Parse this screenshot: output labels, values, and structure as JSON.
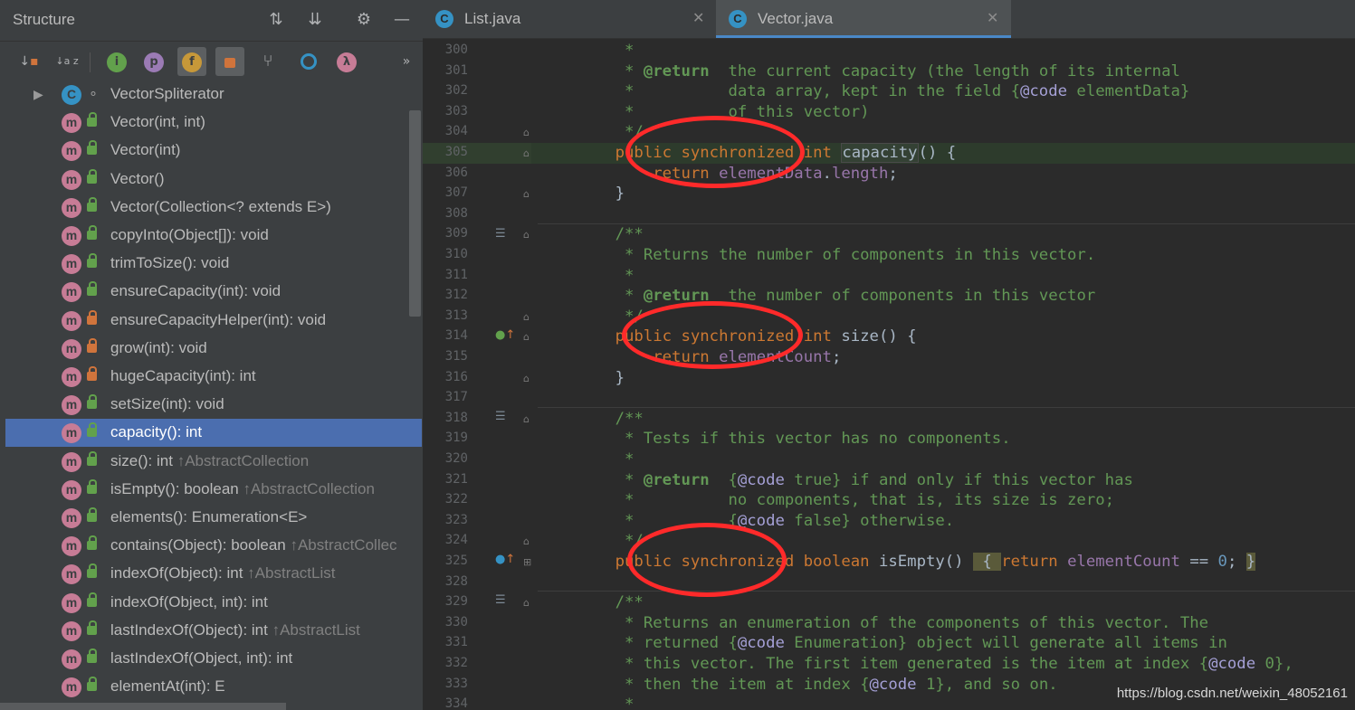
{
  "structure": {
    "title": "Structure",
    "items": [
      {
        "label": "VectorSpliterator",
        "sub": "",
        "kind": "class",
        "access": "package"
      },
      {
        "label": "Vector(int, int)",
        "sub": "",
        "kind": "method",
        "access": "public"
      },
      {
        "label": "Vector(int)",
        "sub": "",
        "kind": "method",
        "access": "public"
      },
      {
        "label": "Vector()",
        "sub": "",
        "kind": "method",
        "access": "public"
      },
      {
        "label": "Vector(Collection<? extends E>)",
        "sub": "",
        "kind": "method",
        "access": "public"
      },
      {
        "label": "copyInto(Object[]): void",
        "sub": "",
        "kind": "method",
        "access": "public"
      },
      {
        "label": "trimToSize(): void",
        "sub": "",
        "kind": "method",
        "access": "public"
      },
      {
        "label": "ensureCapacity(int): void",
        "sub": "",
        "kind": "method",
        "access": "public"
      },
      {
        "label": "ensureCapacityHelper(int): void",
        "sub": "",
        "kind": "method",
        "access": "private"
      },
      {
        "label": "grow(int): void",
        "sub": "",
        "kind": "method",
        "access": "private"
      },
      {
        "label": "hugeCapacity(int): int",
        "sub": "",
        "kind": "method",
        "access": "private"
      },
      {
        "label": "setSize(int): void",
        "sub": "",
        "kind": "method",
        "access": "public"
      },
      {
        "label": "capacity(): int",
        "sub": "",
        "kind": "method",
        "access": "public",
        "selected": true
      },
      {
        "label": "size(): int ",
        "sub": "↑AbstractCollection",
        "kind": "method",
        "access": "public"
      },
      {
        "label": "isEmpty(): boolean ",
        "sub": "↑AbstractCollection",
        "kind": "method",
        "access": "public"
      },
      {
        "label": "elements(): Enumeration<E>",
        "sub": "",
        "kind": "method",
        "access": "public"
      },
      {
        "label": "contains(Object): boolean ",
        "sub": "↑AbstractCollec",
        "kind": "method",
        "access": "public"
      },
      {
        "label": "indexOf(Object): int ",
        "sub": "↑AbstractList",
        "kind": "method",
        "access": "public"
      },
      {
        "label": "indexOf(Object, int): int",
        "sub": "",
        "kind": "method",
        "access": "public"
      },
      {
        "label": "lastIndexOf(Object): int ",
        "sub": "↑AbstractList",
        "kind": "method",
        "access": "public"
      },
      {
        "label": "lastIndexOf(Object, int): int",
        "sub": "",
        "kind": "method",
        "access": "public"
      },
      {
        "label": "elementAt(int): E",
        "sub": "",
        "kind": "method",
        "access": "public"
      }
    ],
    "toolbar": {
      "i_label": "i",
      "p_label": "p",
      "f_label": "f",
      "lambda_label": "λ",
      "more_label": "»",
      "az_label": "a z"
    }
  },
  "tabs": [
    {
      "label": "List.java",
      "active": false
    },
    {
      "label": "Vector.java",
      "active": true
    }
  ],
  "code": {
    "lines": [
      {
        "n": "300",
        "html": "<span class='doc'>     *</span>"
      },
      {
        "n": "301",
        "html": "<span class='doc'>     * </span><span class='tag'>@return</span><span class='doc'>  the current capacity (the length of its internal</span>"
      },
      {
        "n": "302",
        "html": "<span class='doc'>     *          data array, kept in the field {</span><span class='codetag'>@code</span><span class='doc'> elementData}</span>"
      },
      {
        "n": "303",
        "html": "<span class='doc'>     *          of this vector)</span>"
      },
      {
        "n": "304",
        "html": "<span class='doc'>     */</span>"
      },
      {
        "n": "305",
        "html": "    <span class='k'>public synchronized int</span> <span class='ident-hl'>capacity</span>() {",
        "current": true
      },
      {
        "n": "306",
        "html": "        <span class='k'>return</span> <span class='fld'>elementData</span>.<span class='fld'>length</span>;"
      },
      {
        "n": "307",
        "html": "    }"
      },
      {
        "n": "308",
        "html": ""
      },
      {
        "n": "309",
        "html": "<span class='doc'>    /**</span>"
      },
      {
        "n": "310",
        "html": "<span class='doc'>     * Returns the number of components in this vector.</span>"
      },
      {
        "n": "311",
        "html": "<span class='doc'>     *</span>"
      },
      {
        "n": "312",
        "html": "<span class='doc'>     * </span><span class='tag'>@return</span><span class='doc'>  the number of components in this vector</span>"
      },
      {
        "n": "313",
        "html": "<span class='doc'>     */</span>"
      },
      {
        "n": "314",
        "html": "    <span class='k'>public synchronized int</span> size() {"
      },
      {
        "n": "315",
        "html": "        <span class='k'>return</span> <span class='fld'>elementCount</span>;"
      },
      {
        "n": "316",
        "html": "    }"
      },
      {
        "n": "317",
        "html": ""
      },
      {
        "n": "318",
        "html": "<span class='doc'>    /**</span>"
      },
      {
        "n": "319",
        "html": "<span class='doc'>     * Tests if this vector has no components.</span>"
      },
      {
        "n": "320",
        "html": "<span class='doc'>     *</span>"
      },
      {
        "n": "321",
        "html": "<span class='doc'>     * </span><span class='tag'>@return</span><span class='doc'>  {</span><span class='codetag'>@code</span><span class='doc'> true} if and only if this vector has</span>"
      },
      {
        "n": "322",
        "html": "<span class='doc'>     *          no components, that is, its size is zero;</span>"
      },
      {
        "n": "323",
        "html": "<span class='doc'>     *          {</span><span class='codetag'>@code</span><span class='doc'> false} otherwise.</span>"
      },
      {
        "n": "324",
        "html": "<span class='doc'>     */</span>"
      },
      {
        "n": "325",
        "html": "    <span class='k'>public synchronized boolean</span> isEmpty() <span class='fold-hl'> { </span><span class='k'>return</span> <span class='fld'>elementCount</span> == <span class='num'>0</span>; <span class='fold-hl'>}</span>"
      },
      {
        "n": "328",
        "html": ""
      },
      {
        "n": "329",
        "html": "<span class='doc'>    /**</span>"
      },
      {
        "n": "330",
        "html": "<span class='doc'>     * Returns an enumeration of the components of this vector. The</span>"
      },
      {
        "n": "331",
        "html": "<span class='doc'>     * returned {</span><span class='codetag'>@code</span><span class='doc'> Enumeration} object will generate all items in</span>"
      },
      {
        "n": "332",
        "html": "<span class='doc'>     * this vector. The first item generated is the item at index {</span><span class='codetag'>@code</span><span class='doc'> 0},</span>"
      },
      {
        "n": "333",
        "html": "<span class='doc'>     * then the item at index {</span><span class='codetag'>@code</span><span class='doc'> 1}, and so on.</span>"
      },
      {
        "n": "334",
        "html": "<span class='doc'>     *</span>"
      }
    ]
  },
  "watermark": "https://blog.csdn.net/weixin_48052161",
  "colors": {
    "accent": "#4a88c7",
    "selection": "#4b6eaf",
    "annotation": "#ff2a2a"
  }
}
